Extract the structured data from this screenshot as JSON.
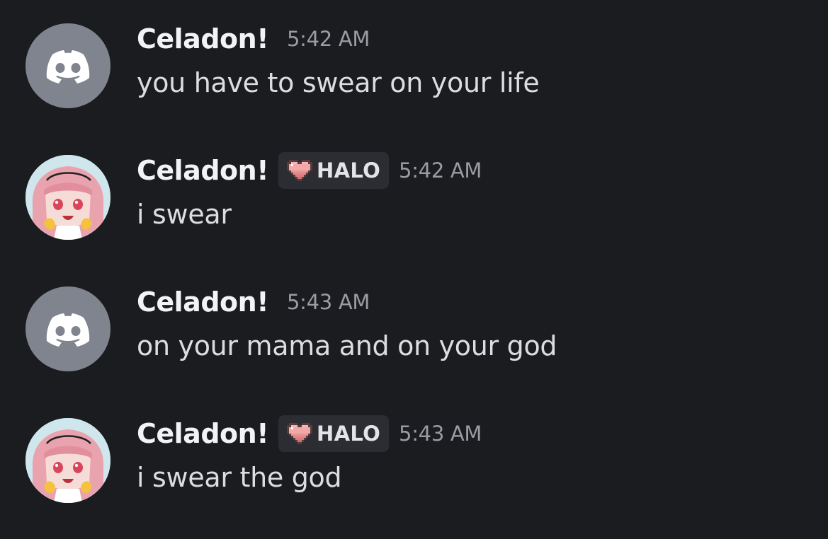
{
  "messages": [
    {
      "avatar": "discord-default-avatar",
      "username": "Celadon!",
      "tag": null,
      "timestamp": "5:42 AM",
      "text": "you have to swear on your life"
    },
    {
      "avatar": "anime-character-avatar",
      "username": "Celadon!",
      "tag": "HALO",
      "tag_icon": "pixel-heart-icon",
      "timestamp": "5:42 AM",
      "text": "i swear"
    },
    {
      "avatar": "discord-default-avatar",
      "username": "Celadon!",
      "tag": null,
      "timestamp": "5:43 AM",
      "text": "on your mama and on your god"
    },
    {
      "avatar": "anime-character-avatar",
      "username": "Celadon!",
      "tag": "HALO",
      "tag_icon": "pixel-heart-icon",
      "timestamp": "5:43 AM",
      "text": "i swear the god"
    }
  ],
  "colors": {
    "background": "#1b1c20",
    "username": "#f2f3f5",
    "message_text": "#dbdee1",
    "timestamp": "#9a9ca4",
    "tag_background": "#2b2d33",
    "default_avatar": "#80848e",
    "heart": "#f0a8a8"
  }
}
